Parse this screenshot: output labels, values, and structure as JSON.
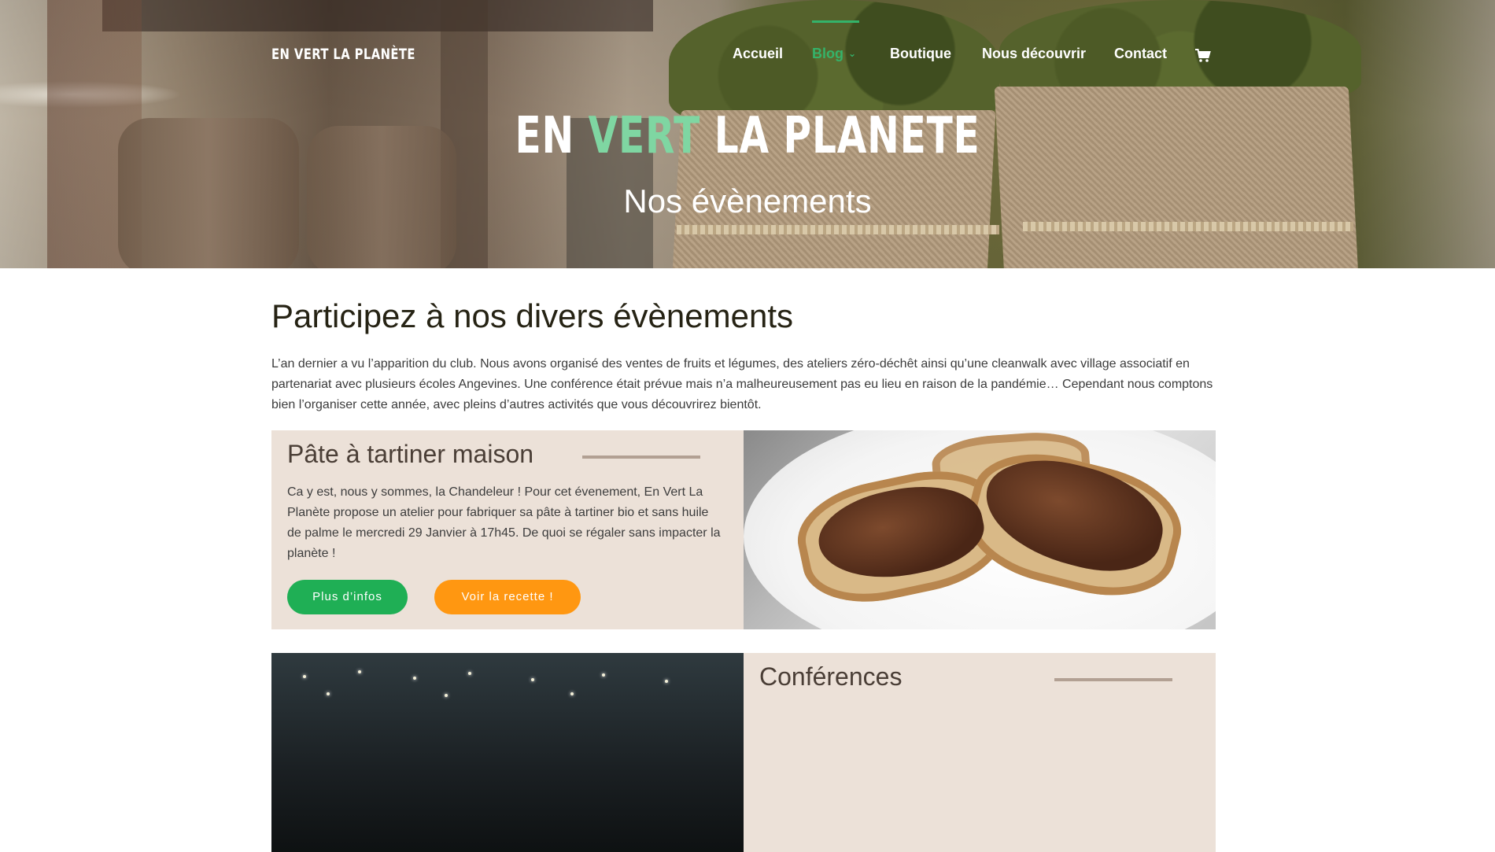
{
  "header": {
    "logo_text": "EN VERT LA PLANÈTE",
    "nav": {
      "accueil": "Accueil",
      "blog": "Blog",
      "boutique": "Boutique",
      "nous_decouvrir": "Nous découvrir",
      "contact": "Contact"
    },
    "active_item": "Blog",
    "icons": {
      "cart": "shopping-cart-icon",
      "dropdown": "chevron-down-icon"
    }
  },
  "hero": {
    "title_part1": "EN",
    "title_part2": "VERT",
    "title_part3": "LA PLANETE",
    "subtitle": "Nos évènements"
  },
  "main": {
    "title": "Participez à nos divers évènements",
    "intro": "L’an dernier a vu l’apparition du club. Nous avons organisé des ventes de fruits et légumes, des ateliers zéro-déchêt ainsi qu’une cleanwalk avec village associatif en partenariat avec plusieurs écoles Angevines. Une conférence était prévue mais n’a malheureusement pas eu lieu en raison de la pandémie… Cependant nous comptons bien l’organiser cette année, avec pleins d’autres activités que vous découvrirez bientôt.",
    "events": [
      {
        "title": "Pâte à tartiner maison",
        "description": "Ca y est, nous y sommes, la Chandeleur ! Pour cet évenement, En Vert La Planète propose un atelier pour fabriquer sa pâte à tartiner bio et sans huile de palme le mercredi 29 Janvier à 17h45. De quoi se régaler sans impacter la planète !",
        "button_info": "Plus d’infos",
        "button_recipe": "Voir la recette !"
      },
      {
        "title": "Conférences"
      }
    ]
  },
  "colors": {
    "accent_green": "#34b36a",
    "title_green": "#7fd6a2",
    "button_green": "#1faf55",
    "button_orange": "#ff9711",
    "card_bg": "#ece1d8",
    "rule": "#b2a093"
  }
}
